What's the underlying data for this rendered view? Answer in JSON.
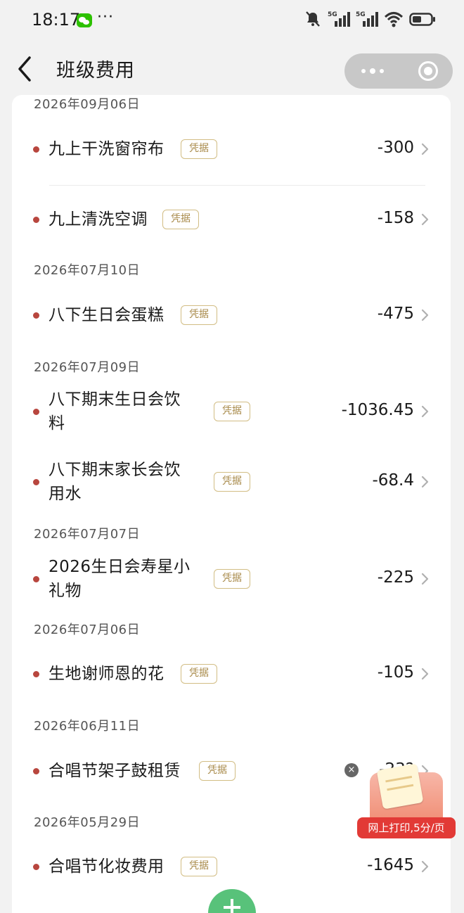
{
  "status_bar": {
    "time": "18:17",
    "more": "···",
    "network_1": "5G",
    "network_2": "5G"
  },
  "nav": {
    "title": "班级费用"
  },
  "receipt_tag_label": "凭据",
  "groups": [
    {
      "date": "2026年09月06日",
      "items": [
        {
          "name_lines": [
            "九上干洗窗帘布"
          ],
          "amount": "-300"
        },
        {
          "name_lines": [
            "九上清洗空调"
          ],
          "amount": "-158"
        }
      ]
    },
    {
      "date": "2026年07月10日",
      "items": [
        {
          "name_lines": [
            "八下生日会蛋糕"
          ],
          "amount": "-475"
        }
      ]
    },
    {
      "date": "2026年07月09日",
      "items": [
        {
          "name_lines": [
            "八下期末生日会饮",
            "料"
          ],
          "amount": "-1036.45"
        },
        {
          "name_lines": [
            "八下期末家长会饮",
            "用水"
          ],
          "amount": "-68.4"
        }
      ]
    },
    {
      "date": "2026年07月07日",
      "items": [
        {
          "name_lines": [
            "2026生日会寿星小",
            "礼物"
          ],
          "amount": "-225"
        }
      ]
    },
    {
      "date": "2026年07月06日",
      "items": [
        {
          "name_lines": [
            "生地谢师恩的花"
          ],
          "amount": "-105"
        }
      ]
    },
    {
      "date": "2026年06月11日",
      "items": [
        {
          "name_lines": [
            "合唱节架子鼓租赁"
          ],
          "amount": "-23?"
        }
      ]
    },
    {
      "date": "2026年05月29日",
      "items": [
        {
          "name_lines": [
            "合唱节化妆费用"
          ],
          "amount": "-1645"
        }
      ]
    }
  ],
  "ad": {
    "label": "网上打印,5分/页",
    "close": "×"
  },
  "colors": {
    "dot": "#b8463e",
    "tag_border": "#d2bd84",
    "tag_text": "#a88a4a",
    "fab": "#58c27a",
    "ad_label": "#e23a36"
  }
}
